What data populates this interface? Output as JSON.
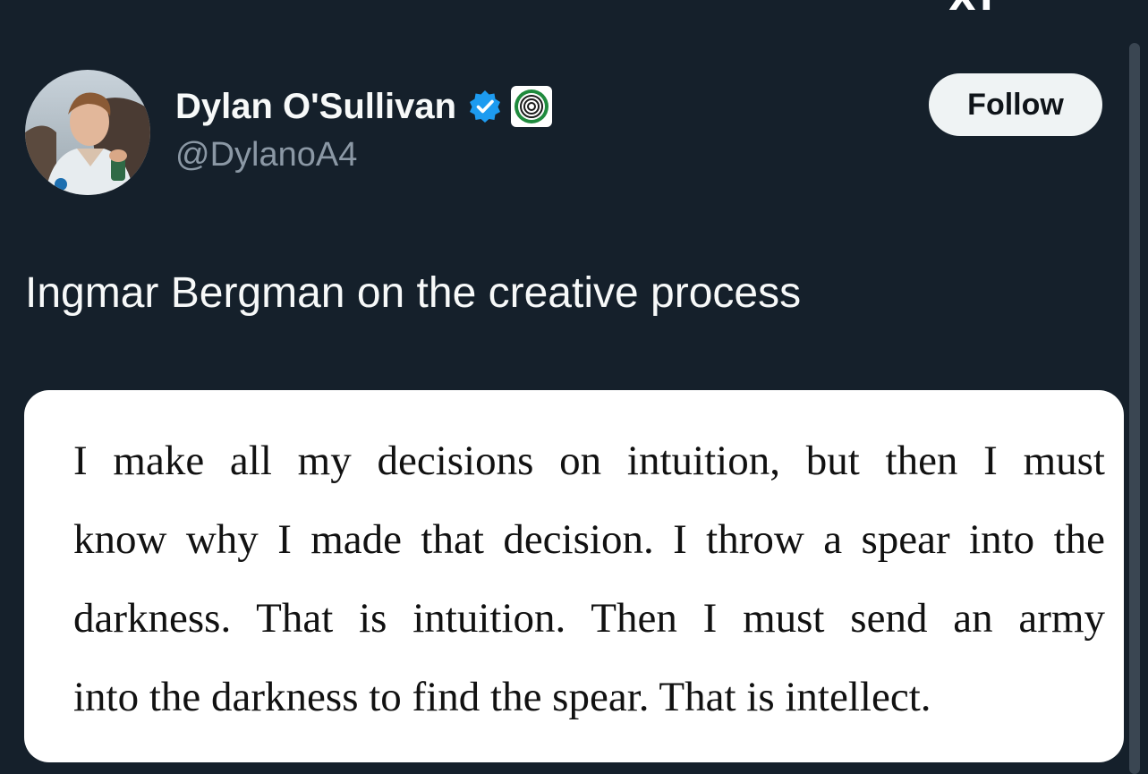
{
  "header": {
    "top_glyph": "XI"
  },
  "author": {
    "display_name": "Dylan O'Sullivan",
    "handle": "@DylanoA4",
    "verified": true,
    "icons": [
      "avatar-photo",
      "verified-badge-icon",
      "affiliate-badge-icon"
    ]
  },
  "actions": {
    "follow_label": "Follow"
  },
  "tweet": {
    "text": "Ingmar Bergman on the creative process"
  },
  "quote_image": {
    "lines": [
      "I make all my decisions on intuition, but then I must",
      "know why I made that decision. I throw a spear into the",
      "darkness. That is intuition. Then I must send an army",
      "into the darkness to find the spear. That is intellect."
    ]
  },
  "colors": {
    "background": "#15202b",
    "primary_text": "#f7f9f9",
    "secondary_text": "#8b98a5",
    "verified_blue": "#1d9bf0",
    "follow_button_bg": "#eff3f4",
    "affiliate_green": "#1f8a3d"
  }
}
